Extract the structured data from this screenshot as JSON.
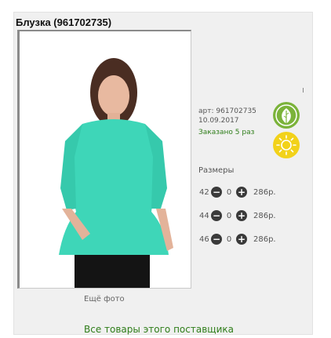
{
  "product": {
    "title": "Блузка (961702735)",
    "article": "арт: 961702735",
    "date": "10.09.2017",
    "ordered": "Заказано 5 раз"
  },
  "sizes": {
    "title": "Размеры",
    "rows": [
      {
        "size": "42",
        "qty": "0",
        "price": "286р."
      },
      {
        "size": "44",
        "qty": "0",
        "price": "286р."
      },
      {
        "size": "46",
        "qty": "0",
        "price": "286р."
      }
    ]
  },
  "links": {
    "more_photo": "Ещё фото",
    "supplier": "Все товары этого поставщика"
  },
  "icons": {
    "eco": "leaf-icon",
    "sun": "sun-icon",
    "minus": "minus-circle-icon",
    "plus": "plus-circle-icon"
  },
  "colors": {
    "accent_green": "#2e7d19",
    "eco_green": "#7bb33a",
    "sun_yellow": "#f2d21a",
    "blouse": "#3ed6b8"
  }
}
